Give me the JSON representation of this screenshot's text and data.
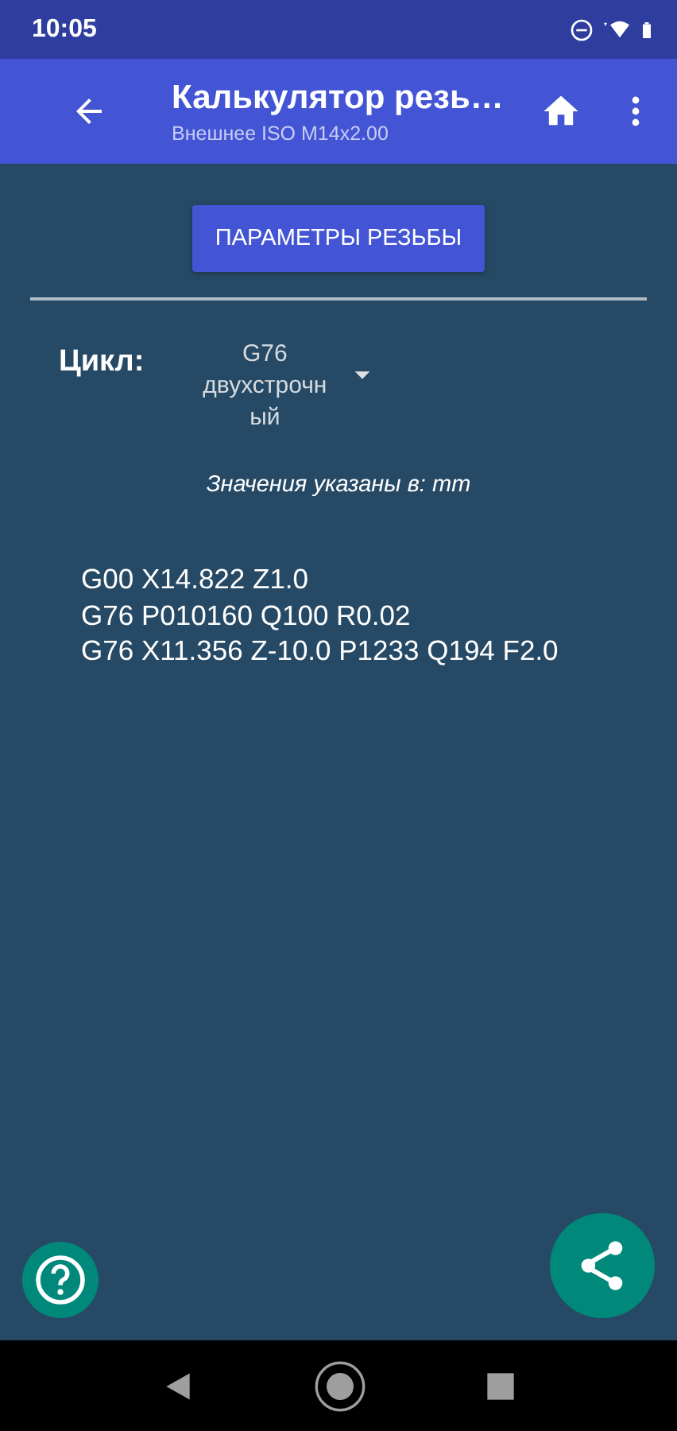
{
  "status_bar": {
    "time": "10:05"
  },
  "app_bar": {
    "title": "Калькулятор резь…",
    "subtitle": "Внешнее ISO M14x2.00"
  },
  "params_button": {
    "label": "ПАРАМЕТРЫ РЕЗЬБЫ"
  },
  "cycle": {
    "label": "Цикл:",
    "value": "G76 двухстрочный"
  },
  "units_note": "Значения указаны в: mm",
  "code_lines": [
    "G00 X14.822 Z1.0",
    "G76 P010160 Q100 R0.02",
    "G76 X11.356 Z-10.0 P1233 Q194 F2.0"
  ]
}
